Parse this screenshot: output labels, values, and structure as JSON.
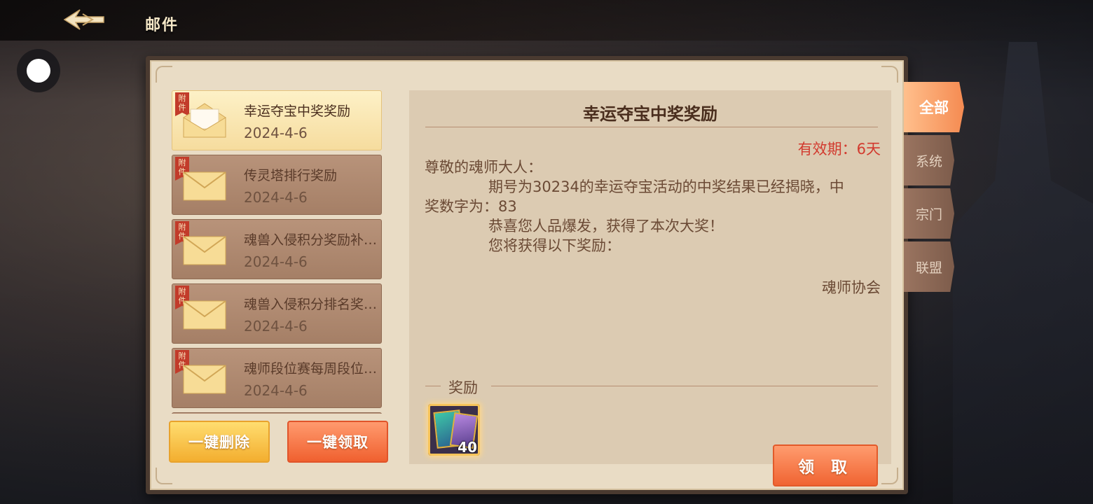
{
  "header": {
    "title": "邮件"
  },
  "mails": [
    {
      "tag": "附件",
      "subject": "幸运夺宝中奖奖励",
      "date": "2024-4-6",
      "selected": true
    },
    {
      "tag": "附件",
      "subject": "传灵塔排行奖励",
      "date": "2024-4-6",
      "selected": false
    },
    {
      "tag": "附件",
      "subject": "魂兽入侵积分奖励补…",
      "date": "2024-4-6",
      "selected": false
    },
    {
      "tag": "附件",
      "subject": "魂兽入侵积分排名奖…",
      "date": "2024-4-6",
      "selected": false
    },
    {
      "tag": "附件",
      "subject": "魂师段位赛每周段位…",
      "date": "2024-4-6",
      "selected": false
    }
  ],
  "actions": {
    "delete_all": "一键删除",
    "claim_all": "一键领取"
  },
  "detail": {
    "title": "幸运夺宝中奖奖励",
    "expiry": "有效期：6天",
    "greeting": "尊敬的魂师大人：",
    "line1": "期号为30234的幸运夺宝活动的中奖结果已经揭晓，中",
    "line1b": "奖数字为：83",
    "line2": "恭喜您人品爆发，获得了本次大奖！",
    "line3": "您将获得以下奖励：",
    "sender": "魂师协会",
    "reward_label": "奖励",
    "reward_qty": "40",
    "claim": "领 取"
  },
  "tabs": [
    {
      "label": "全部",
      "active": true
    },
    {
      "label": "系统",
      "active": false
    },
    {
      "label": "宗门",
      "active": false
    },
    {
      "label": "联盟",
      "active": false
    }
  ],
  "colors": {
    "accent": "#f06432",
    "expiry": "#d23a2e",
    "panel": "#e9dcc5"
  }
}
